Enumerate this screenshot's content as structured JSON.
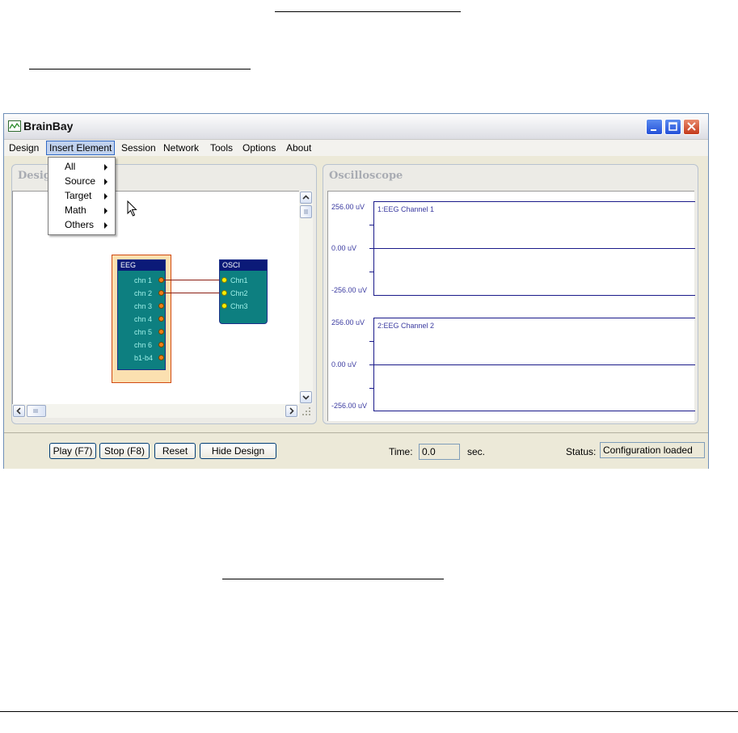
{
  "window": {
    "title": "BrainBay"
  },
  "menubar": {
    "items": [
      "Design",
      "Insert Element",
      "Session",
      "Network",
      "Tools",
      "Options",
      "About"
    ],
    "active": "Insert Element"
  },
  "dropdown": {
    "items": [
      "All",
      "Source",
      "Target",
      "Math",
      "Others"
    ]
  },
  "design_panel": {
    "title": "Design"
  },
  "osc_panel": {
    "title": "Oscilloscope"
  },
  "eeg_block": {
    "title": "EEG",
    "ports": [
      "chn 1",
      "chn 2",
      "chn 3",
      "chn 4",
      "chn 5",
      "chn 6",
      "b1-b4"
    ]
  },
  "osci_block": {
    "title": "OSCI",
    "ports": [
      "Chn1",
      "Chn2",
      "Chn3"
    ]
  },
  "oscilloscope": {
    "channels": [
      {
        "name": "1:EEG Channel 1",
        "top": "256.00 uV",
        "mid": "0.00 uV",
        "bottom": "-256.00 uV"
      },
      {
        "name": "2:EEG Channel 2",
        "top": "256.00 uV",
        "mid": "0.00 uV",
        "bottom": "-256.00 uV"
      }
    ]
  },
  "bottombar": {
    "buttons": [
      "Play (F7)",
      "Stop (F8)",
      "Reset",
      "Hide Design"
    ],
    "time_label": "Time:",
    "time_value": "0.0",
    "time_unit": "sec.",
    "status_label": "Status:",
    "status_value": "Configuration loaded"
  },
  "colors": {
    "block_fill": "#0d7f80",
    "block_header": "#0b1a78",
    "wire": "#8a1d12",
    "trace": "#1a1a8a"
  }
}
